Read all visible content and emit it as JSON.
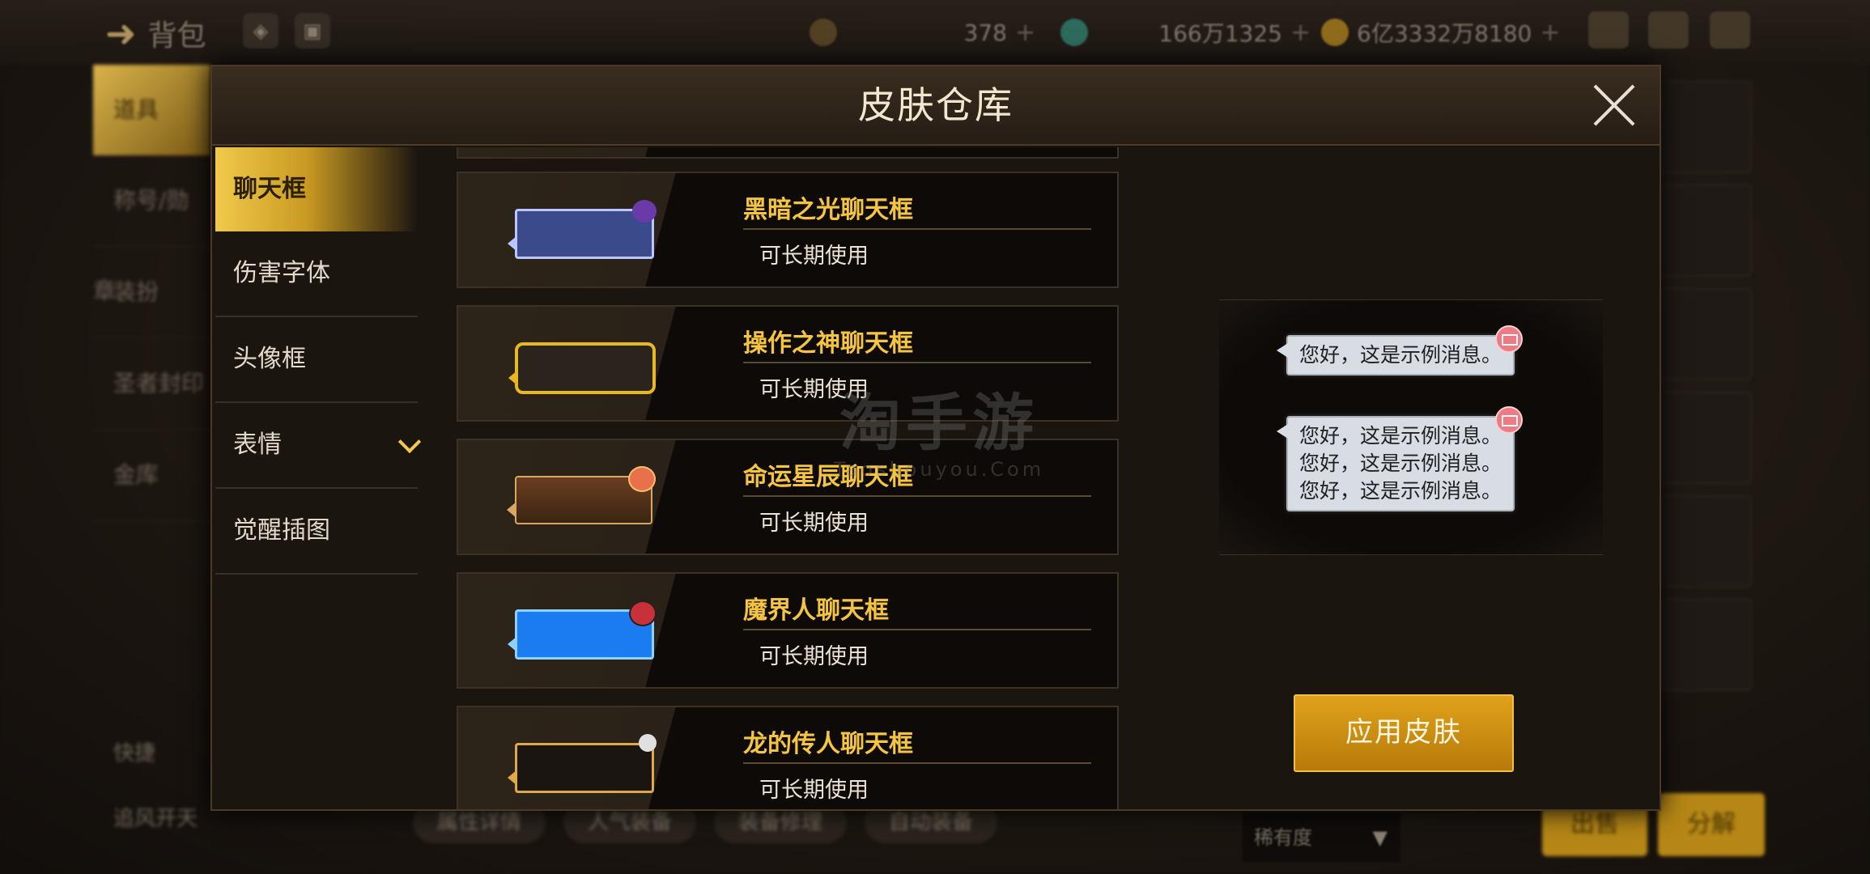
{
  "background": {
    "back_label": "背包",
    "currencies": [
      {
        "value": "378",
        "icon": "moon-coin-icon"
      },
      {
        "value": "166万1325",
        "icon": "gem-icon"
      },
      {
        "value": "6亿3332万8180",
        "icon": "gold-coin-icon"
      }
    ],
    "left_tabs": [
      "道具",
      "称号/勋章",
      "装扮",
      "圣者封印",
      "金库"
    ],
    "bottom_buttons": [
      "属性详情",
      "人气装备",
      "装备修理",
      "自动装备"
    ],
    "bottom_left": [
      "快捷",
      "追风开天"
    ],
    "sort_label": "稀有度",
    "sell_label": "出售",
    "decompose_label": "分解"
  },
  "modal": {
    "title": "皮肤仓库",
    "tabs": [
      {
        "label": "聊天框",
        "active": true
      },
      {
        "label": "伤害字体",
        "active": false
      },
      {
        "label": "头像框",
        "active": false
      },
      {
        "label": "表情",
        "active": false,
        "expandable": true
      },
      {
        "label": "觉醒插图",
        "active": false
      }
    ],
    "items": [
      {
        "name": "黑暗之光聊天框",
        "desc": "可长期使用",
        "frame_color": "#3a4a8a",
        "border_color": "#b9c6ff",
        "deco_color": "#6a3aa8"
      },
      {
        "name": "操作之神聊天框",
        "desc": "可长期使用",
        "frame_color": "#2a241c",
        "border_color": "#e8b820",
        "deco_color": "#c99a22"
      },
      {
        "name": "命运星辰聊天框",
        "desc": "可长期使用",
        "frame_color": "#5a341c",
        "border_color": "#d9a860",
        "deco_color": "#e8704a"
      },
      {
        "name": "魔界人聊天框",
        "desc": "可长期使用",
        "frame_color": "#1a7cf0",
        "border_color": "#8fd0ff",
        "deco_color": "#c8303a"
      },
      {
        "name": "龙的传人聊天框",
        "desc": "可长期使用",
        "frame_color": "#1a1510",
        "border_color": "#e0a848",
        "deco_color": "#e0e0e0"
      }
    ],
    "preview": {
      "single_message": "您好，这是示例消息。",
      "multi_message": [
        "您好，这是示例消息。",
        "您好，这是示例消息。",
        "您好，这是示例消息。"
      ]
    },
    "apply_label": "应用皮肤"
  },
  "watermark": {
    "cn": "淘手游",
    "en": "Taoshouyou.Com"
  }
}
